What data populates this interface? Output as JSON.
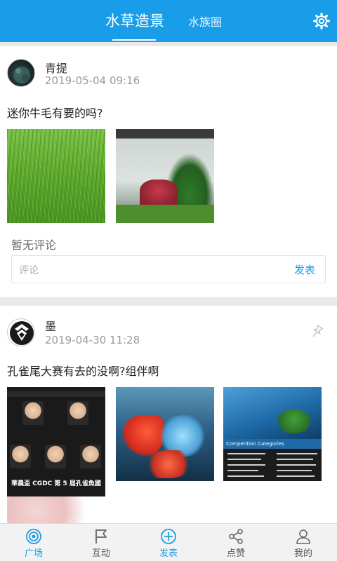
{
  "header": {
    "tabs": [
      {
        "label": "水草造景",
        "active": true
      },
      {
        "label": "水族圈",
        "active": false
      }
    ],
    "settings_icon": "gear-icon",
    "accent_color": "#1a9de8"
  },
  "posts": [
    {
      "username": "青提",
      "timestamp": "2019-05-04 09:16",
      "text": "迷你牛毛有要的吗?",
      "no_comment": "暂无评论",
      "comment_placeholder": "评论",
      "send_label": "发表"
    },
    {
      "username": "墨",
      "timestamp": "2019-04-30 11:28",
      "text": "孔雀尾大赛有去的没啊?组伴啊",
      "image_a_caption": "華晨盃 CGDC 第 5 屆孔雀魚國",
      "image_c_caption": "Competition Categories"
    }
  ],
  "bottom_nav": [
    {
      "label": "广场",
      "icon": "broadcast-icon",
      "active": true
    },
    {
      "label": "互动",
      "icon": "flag-icon",
      "active": false
    },
    {
      "label": "发表",
      "icon": "add-circle-icon",
      "active": false
    },
    {
      "label": "点赞",
      "icon": "share-icon",
      "active": false
    },
    {
      "label": "我的",
      "icon": "user-icon",
      "active": false
    }
  ]
}
